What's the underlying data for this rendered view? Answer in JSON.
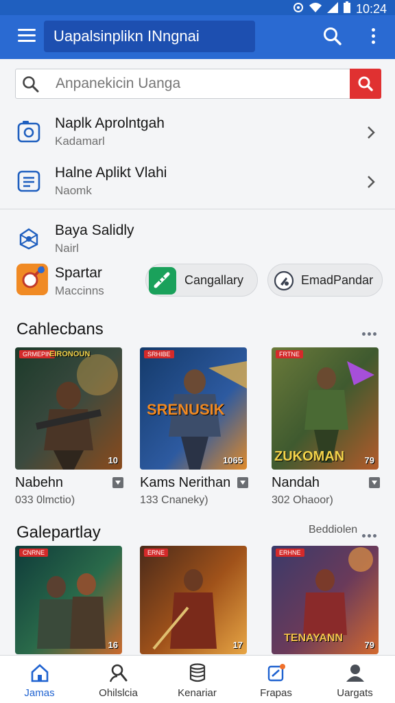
{
  "status_bar": {
    "time": "10:24"
  },
  "app_bar": {
    "title": "Uapalsinplikn INngnai"
  },
  "search": {
    "placeholder": "Anpanekicin Uanga"
  },
  "list_items": [
    {
      "title": "Naplk Aprolntgah",
      "subtitle": "Kadamarl"
    },
    {
      "title": "Halne Aplikt Vlahi",
      "subtitle": "Naomk"
    },
    {
      "title": "Baya Salidly",
      "subtitle": "Nairl"
    },
    {
      "title": "Spartar",
      "subtitle": "Maccinns"
    }
  ],
  "pills": [
    {
      "label": "Cangallary"
    },
    {
      "label": "EmadPandar"
    }
  ],
  "sections": [
    {
      "title": "Cahlecbans",
      "cards": [
        {
          "title": "Nabehn",
          "subtitle": "033 0lmctio)",
          "badge": "GRMEPIN",
          "banner": "EIRONOUN",
          "rating": "10"
        },
        {
          "title": "Kams Nerithan",
          "subtitle": "133 Cnaneky)",
          "badge": "SRHIBE",
          "banner": "SRENUSIK",
          "rating": "1065"
        },
        {
          "title": "Nandah",
          "subtitle": "302 Ohaoor)",
          "badge": "FRTNE",
          "banner": "ZUKOMAN",
          "rating": "79"
        }
      ]
    },
    {
      "title": "Galepartlay",
      "link": "Beddiolen",
      "cards": [
        {
          "title": "",
          "subtitle": "",
          "badge": "CNRNE",
          "banner": "",
          "rating": "16"
        },
        {
          "title": "",
          "subtitle": "",
          "badge": "ERNE",
          "banner": "",
          "rating": "17"
        },
        {
          "title": "",
          "subtitle": "",
          "badge": "ERHNE",
          "banner": "TENAYANN",
          "rating": "79"
        }
      ]
    }
  ],
  "bottom_nav": [
    {
      "label": "Jamas",
      "icon": "home-icon",
      "active": true
    },
    {
      "label": "Ohilslcia",
      "icon": "person-search-icon",
      "active": false
    },
    {
      "label": "Kenariar",
      "icon": "database-icon",
      "active": false
    },
    {
      "label": "Frapas",
      "icon": "notification-icon",
      "active": false
    },
    {
      "label": "Uargats",
      "icon": "account-icon",
      "active": false
    }
  ],
  "colors": {
    "app_bar": "#2a6ad2",
    "status_bar": "#1f5fbf",
    "accent_red": "#e03131",
    "nav_active": "#1f62d0"
  }
}
